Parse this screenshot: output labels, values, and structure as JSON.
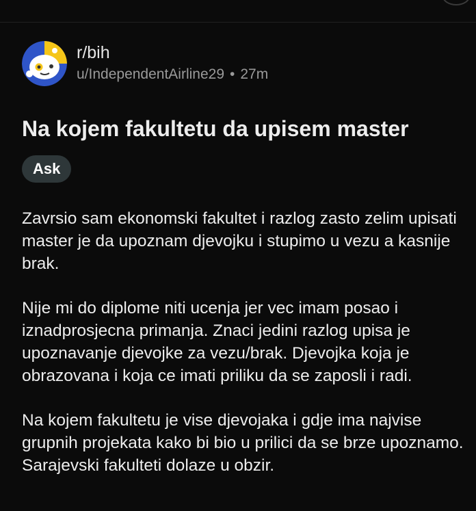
{
  "post": {
    "subreddit": "r/bih",
    "author": "u/IndependentAirline29",
    "separator": "•",
    "time": "27m",
    "title": "Na kojem fakultetu da upisem master",
    "flair": "Ask",
    "paragraphs": [
      "Zavrsio sam ekonomski fakultet i razlog zasto zelim upisati master je da upoznam djevojku i stupimo u vezu a kasnije brak.",
      "Nije mi do diplome niti ucenja jer vec imam posao i iznadprosjecna primanja. Znaci jedini razlog upisa je upoznavanje djevojke za vezu/brak. Djevojka koja je obrazovana i koja ce imati priliku da se zaposli i radi.",
      "Na kojem fakultetu je vise djevojaka i gdje ima najvise grupnih projekata kako bi bio u prilici da se brze upoznamo. Sarajevski fakulteti dolaze u obzir."
    ]
  },
  "icons": {
    "avatar": "subreddit-avatar-icon"
  },
  "colors": {
    "background": "#0b0b0b",
    "text_primary": "#ededed",
    "text_secondary": "#9a9a9a",
    "flair_background": "#2e3739",
    "avatar_blue": "#2f55c8",
    "avatar_yellow": "#f5c518"
  }
}
